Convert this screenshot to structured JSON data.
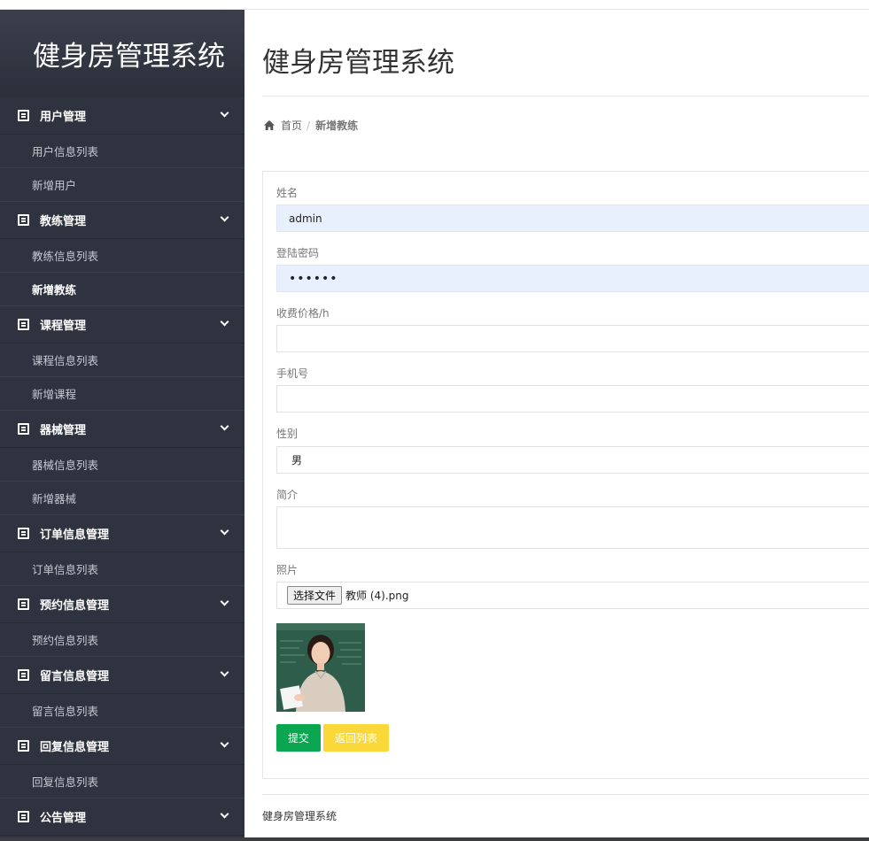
{
  "app": {
    "brand": "健身房管理系统"
  },
  "sidebar": {
    "groups": [
      {
        "title": "用户管理",
        "items": [
          "用户信息列表",
          "新增用户"
        ]
      },
      {
        "title": "教练管理",
        "items": [
          "教练信息列表",
          "新增教练"
        ]
      },
      {
        "title": "课程管理",
        "items": [
          "课程信息列表",
          "新增课程"
        ]
      },
      {
        "title": "器械管理",
        "items": [
          "器械信息列表",
          "新增器械"
        ]
      },
      {
        "title": "订单信息管理",
        "items": [
          "订单信息列表"
        ]
      },
      {
        "title": "预约信息管理",
        "items": [
          "预约信息列表"
        ]
      },
      {
        "title": "留言信息管理",
        "items": [
          "留言信息列表"
        ]
      },
      {
        "title": "回复信息管理",
        "items": [
          "回复信息列表"
        ]
      },
      {
        "title": "公告管理",
        "items": []
      }
    ],
    "active_item": "新增教练"
  },
  "main": {
    "title": "健身房管理系统",
    "breadcrumb": {
      "home": "首页",
      "separator": "/",
      "current": "新增教练"
    }
  },
  "form": {
    "name": {
      "label": "姓名",
      "value": "admin"
    },
    "password": {
      "label": "登陆密码",
      "value": "••••••"
    },
    "price": {
      "label": "收费价格/h",
      "value": ""
    },
    "phone": {
      "label": "手机号",
      "value": ""
    },
    "gender": {
      "label": "性别",
      "value": "男"
    },
    "intro": {
      "label": "简介",
      "value": ""
    },
    "photo": {
      "label": "照片",
      "button": "选择文件",
      "filename": "教师 (4).png"
    },
    "submit": "提交",
    "back": "返回列表"
  },
  "footer": {
    "text": "健身房管理系统"
  },
  "colors": {
    "sidebar_bg": "#2f3340",
    "submit_green": "#0aa650",
    "back_yellow": "#fbd83a",
    "autofill_bg": "#e8f0fe"
  }
}
